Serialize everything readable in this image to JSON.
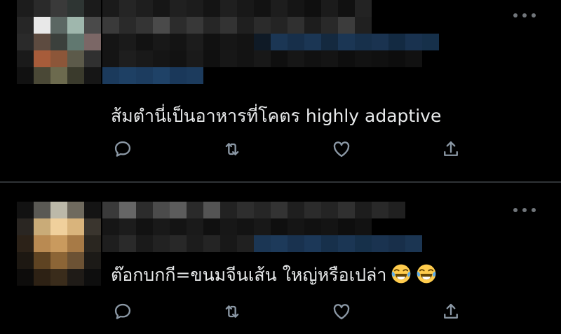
{
  "tweets": [
    {
      "text": "ส้มตำนี่เป็นอาหารที่โคตร highly adaptive",
      "more_icon": "more-horizontal-icon",
      "actions": [
        "reply-icon",
        "retweet-icon",
        "like-icon",
        "share-icon"
      ]
    },
    {
      "text": "ต๊อกบกกี=ขนมจีนเส้น ใหญ่หรือเปล่า",
      "emoji": "face-with-tears-of-joy",
      "more_icon": "more-horizontal-icon",
      "actions": [
        "reply-icon",
        "retweet-icon",
        "like-icon",
        "share-icon"
      ]
    }
  ],
  "colors": {
    "background": "#000000",
    "text": "#e7e9ea",
    "icon": "#8b98a5",
    "divider": "#2f3336",
    "pixelated_link": "#1b3b5c"
  }
}
